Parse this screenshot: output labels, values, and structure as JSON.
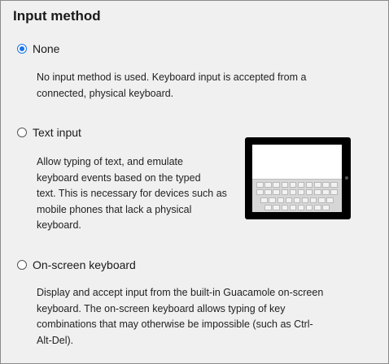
{
  "section": {
    "title": "Input method"
  },
  "options": [
    {
      "label": "None",
      "checked": true,
      "description_lines": [
        "No input method is used. Keyboard input is accepted from a",
        "connected, physical keyboard."
      ]
    },
    {
      "label": "Text input",
      "checked": false,
      "description_lines": [
        "Allow typing of text, and emulate",
        "keyboard events based on the typed",
        "text. This is necessary for devices such as",
        "mobile phones that lack a physical",
        "keyboard."
      ]
    },
    {
      "label": "On-screen keyboard",
      "checked": false,
      "description_lines": [
        "Display and accept input from the built-in Guacamole on-screen",
        "keyboard. The on-screen keyboard allows typing of key",
        "combinations that may otherwise be impossible (such as Ctrl-",
        "Alt-Del)."
      ]
    }
  ],
  "colors": {
    "accent": "#1a73e8",
    "panel_bg": "#f0f0f0",
    "border": "#8a8a8a"
  },
  "icons": {
    "tablet": "tablet-keyboard-icon"
  }
}
